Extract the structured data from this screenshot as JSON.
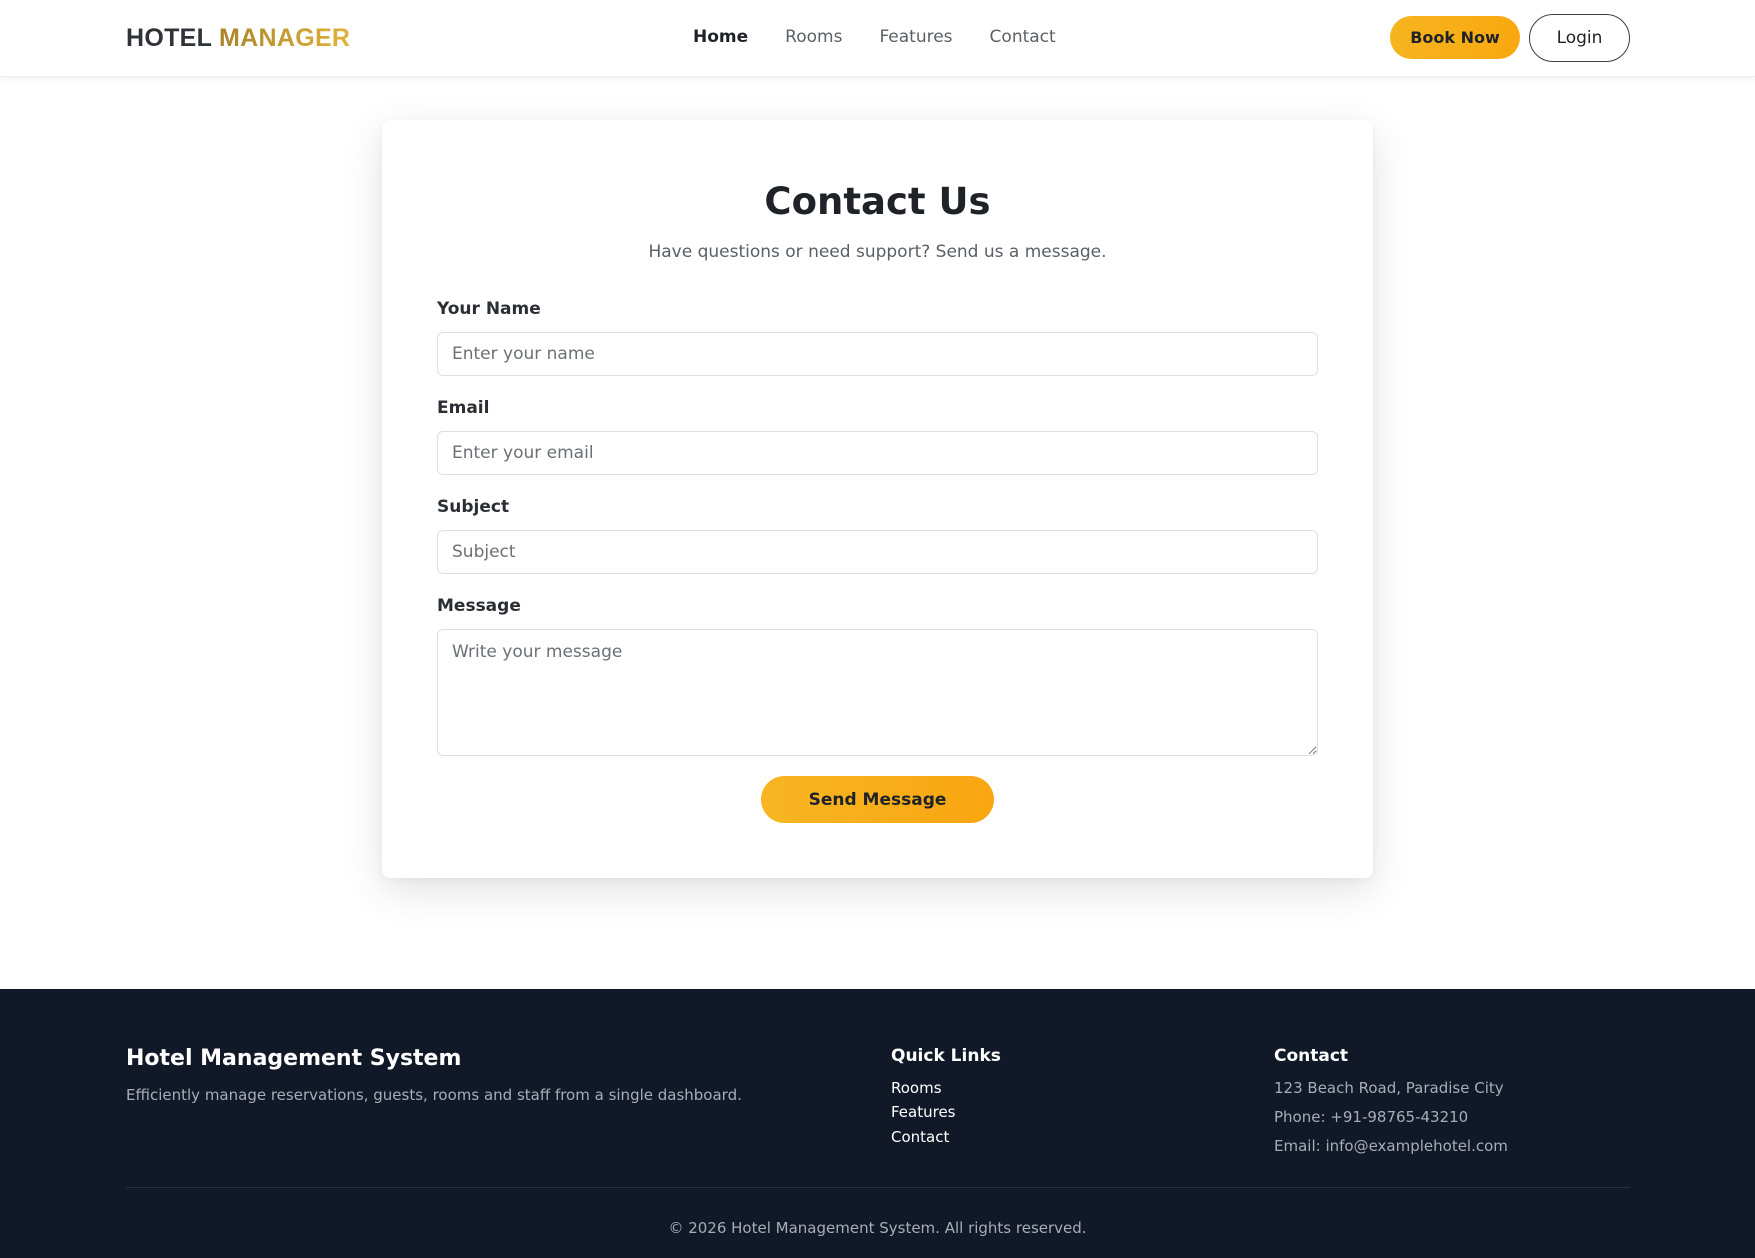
{
  "navbar": {
    "brand_part1": "HOTEL",
    "brand_part2": "MANAGER",
    "links": [
      "Home",
      "Rooms",
      "Features",
      "Contact"
    ],
    "active_link": "Home",
    "book_label": "Book Now",
    "login_label": "Login"
  },
  "form": {
    "title": "Contact Us",
    "subtitle": "Have questions or need support? Send us a message.",
    "name_label": "Your Name",
    "name_placeholder": "Enter your name",
    "email_label": "Email",
    "email_placeholder": "Enter your email",
    "subject_label": "Subject",
    "subject_placeholder": "Subject",
    "message_label": "Message",
    "message_placeholder": "Write your message",
    "submit_label": "Send Message"
  },
  "footer": {
    "title": "Hotel Management System",
    "description": "Efficiently manage reservations, guests, rooms and staff from a single dashboard.",
    "quick_links_heading": "Quick Links",
    "quick_links": [
      "Rooms",
      "Features",
      "Contact"
    ],
    "contact_heading": "Contact",
    "contact_address": "123 Beach Road, Paradise City",
    "contact_phone": "Phone: +91-98765-43210",
    "contact_email": "Email: info@examplehotel.com",
    "copyright": "© 2026 Hotel Management System. All rights reserved."
  },
  "colors": {
    "accent": "#f7b11b",
    "footer_bg": "#111827"
  }
}
